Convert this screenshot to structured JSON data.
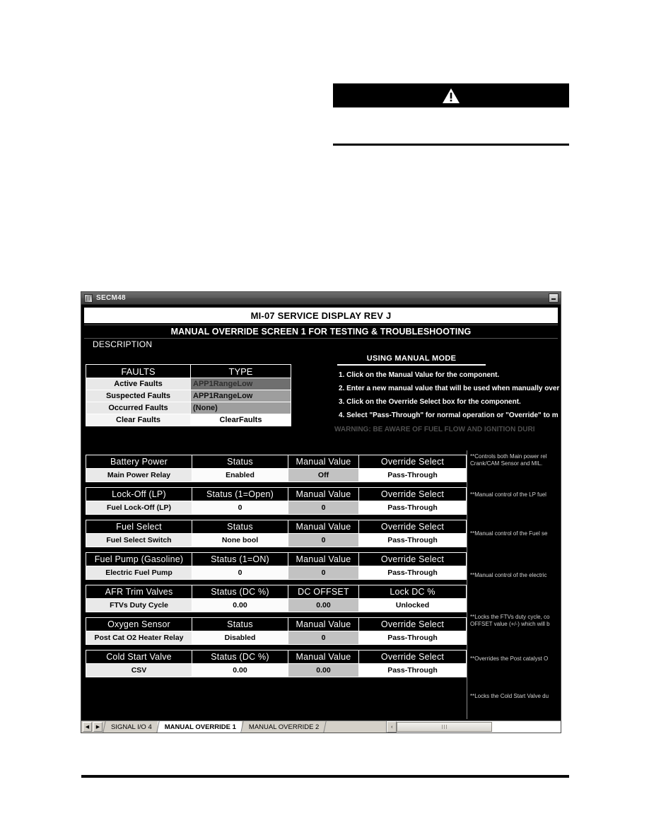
{
  "warning": {
    "icon": "warning-triangle-icon"
  },
  "window": {
    "title": "SECM48",
    "minimize_label": "Minimize"
  },
  "header": {
    "title_banner": "MI-07 SERVICE DISPLAY REV J",
    "subtitle_banner": "MANUAL OVERRIDE SCREEN 1 FOR TESTING & TROUBLESHOOTING",
    "description_label": "DESCRIPTION"
  },
  "faults": {
    "col_name": "FAULTS",
    "col_type": "TYPE",
    "rows": [
      {
        "name": "Active Faults",
        "value": "APP1RangeLow"
      },
      {
        "name": "Suspected Faults",
        "value": "APP1RangeLow"
      },
      {
        "name": "Occurred Faults",
        "value": "(None)"
      },
      {
        "name": "Clear Faults",
        "value": "ClearFaults"
      }
    ]
  },
  "instructions": {
    "title": "USING MANUAL MODE",
    "steps": [
      "1. Click on the Manual Value  for the component.",
      "2. Enter a new manual value that will be used when manually over",
      "3. Click on the Override Select box for the component.",
      "4. Select \"Pass-Through\" for normal operation or \"Override\" to m"
    ],
    "warning": "WARNING: BE AWARE OF FUEL FLOW AND IGNITION DURI"
  },
  "groups": [
    {
      "header": [
        "Battery Power",
        "Status",
        "Manual Value",
        "Override Select"
      ],
      "row": [
        "Main Power Relay",
        "Enabled",
        "Off",
        "Pass-Through"
      ],
      "note": "**Controls both Main power rel\nCrank/CAM Sensor and MIL."
    },
    {
      "header": [
        "Lock-Off (LP)",
        "Status (1=Open)",
        "Manual Value",
        "Override Select"
      ],
      "row": [
        "Fuel Lock-Off (LP)",
        "0",
        "0",
        "Pass-Through"
      ],
      "note": "**Manual control of the LP fuel"
    },
    {
      "header": [
        "Fuel Select",
        "Status",
        "Manual Value",
        "Override Select"
      ],
      "row": [
        "Fuel Select Switch",
        "None bool",
        "0",
        "Pass-Through"
      ],
      "note": "**Manual control of the Fuel se"
    },
    {
      "header": [
        "Fuel Pump (Gasoline)",
        "Status (1=ON)",
        "Manual Value",
        "Override Select"
      ],
      "row": [
        "Electric Fuel Pump",
        "0",
        "0",
        "Pass-Through"
      ],
      "note": "**Manual control of the electric"
    },
    {
      "header": [
        "AFR Trim Valves",
        "Status (DC %)",
        "DC OFFSET",
        "Lock DC %"
      ],
      "row": [
        "FTVs Duty Cycle",
        "0.00",
        "0.00",
        "Unlocked"
      ],
      "note": "**Locks the FTVs duty cycle, co\nOFFSET value (+/-) which will b"
    },
    {
      "header": [
        "Oxygen Sensor",
        "Status",
        "Manual Value",
        "Override Select"
      ],
      "row": [
        "Post Cat O2 Heater Relay",
        "Disabled",
        "0",
        "Pass-Through"
      ],
      "note": "**Overrides the Post catalyst O"
    },
    {
      "header": [
        "Cold Start Valve",
        "Status (DC %)",
        "Manual Value",
        "Override Select"
      ],
      "row": [
        "CSV",
        "0.00",
        "0.00",
        "Pass-Through"
      ],
      "note": "**Locks the Cold Start Valve du"
    }
  ],
  "tabbar": {
    "nav_first": "◀",
    "nav_prev": "▶",
    "tabs": [
      {
        "label": "SIGNAL I/O 4",
        "active": false
      },
      {
        "label": "MANUAL OVERRIDE 1",
        "active": true
      },
      {
        "label": "MANUAL OVERRIDE 2",
        "active": false
      }
    ],
    "scroll_left": "‹"
  }
}
